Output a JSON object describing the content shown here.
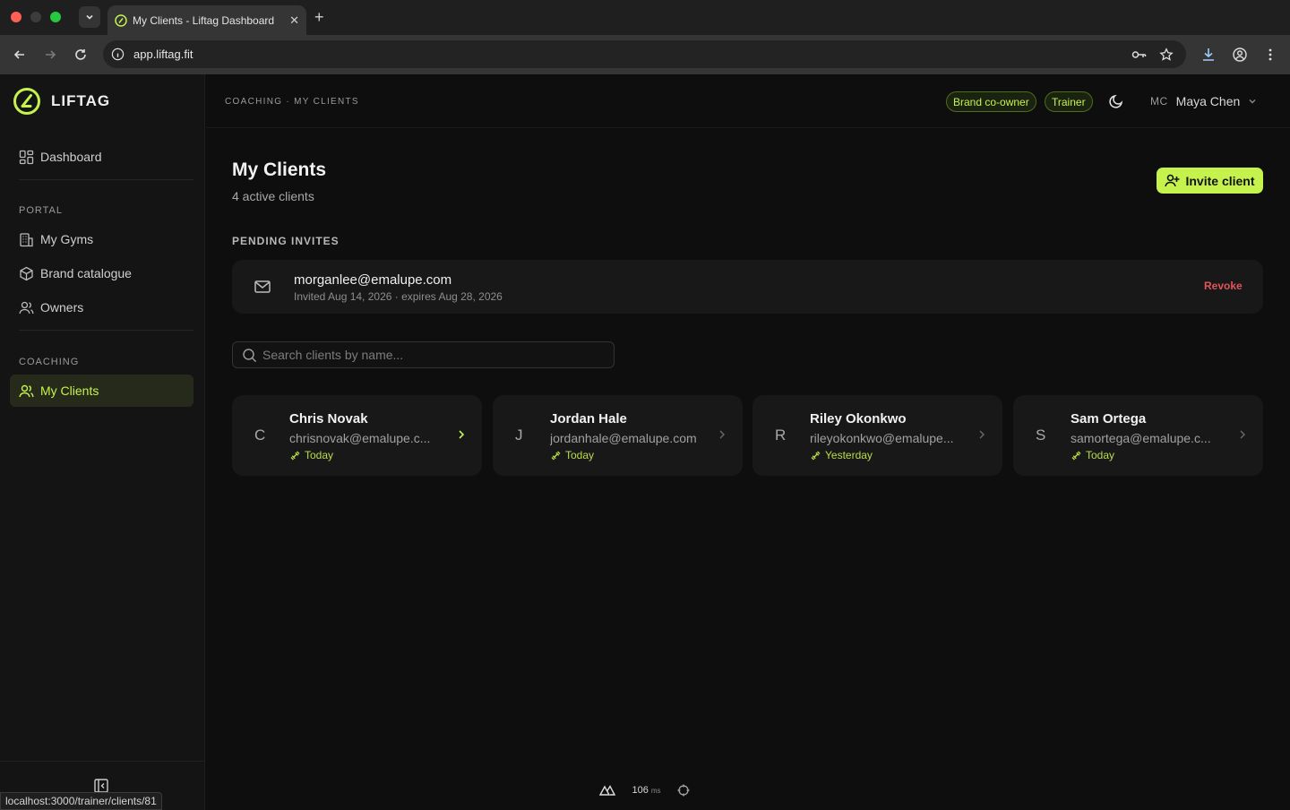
{
  "browser": {
    "tab_title": "My Clients - Liftag Dashboard",
    "url": "app.liftag.fit",
    "status_url": "localhost:3000/trainer/clients/81"
  },
  "colors": {
    "accent": "#c6f24e",
    "danger": "#e0545a",
    "background": "#0e0e0e",
    "card": "#181818"
  },
  "sidebar": {
    "brand": "LIFTAG",
    "dashboard_label": "Dashboard",
    "portal_label": "PORTAL",
    "portal_items": [
      {
        "label": "My Gyms",
        "icon": "building-icon"
      },
      {
        "label": "Brand catalogue",
        "icon": "box-icon"
      },
      {
        "label": "Owners",
        "icon": "users-icon"
      }
    ],
    "coaching_label": "COACHING",
    "coaching_items": [
      {
        "label": "My Clients",
        "icon": "users-icon",
        "active": true
      }
    ]
  },
  "header": {
    "breadcrumb": "COACHING · MY CLIENTS",
    "badges": [
      "Brand co-owner",
      "Trainer"
    ],
    "user_initials": "MC",
    "user_name": "Maya Chen"
  },
  "page": {
    "title": "My Clients",
    "subtitle": "4 active clients",
    "invite_button": "Invite client",
    "pending_label": "PENDING INVITES",
    "pending_invites": [
      {
        "email": "morganlee@emalupe.com",
        "meta": "Invited Aug 14, 2026 · expires Aug 28, 2026",
        "action": "Revoke"
      }
    ],
    "search_placeholder": "Search clients by name...",
    "clients": [
      {
        "initial": "C",
        "name": "Chris Novak",
        "email": "chrisnovak@emalupe.c...",
        "last_active": "Today"
      },
      {
        "initial": "J",
        "name": "Jordan Hale",
        "email": "jordanhale@emalupe.com",
        "last_active": "Today"
      },
      {
        "initial": "R",
        "name": "Riley Okonkwo",
        "email": "rileyokonkwo@emalupe...",
        "last_active": "Yesterday"
      },
      {
        "initial": "S",
        "name": "Sam Ortega",
        "email": "samortega@emalupe.c...",
        "last_active": "Today"
      }
    ]
  },
  "dev_toolbar": {
    "timing": "106",
    "unit": "ms"
  }
}
